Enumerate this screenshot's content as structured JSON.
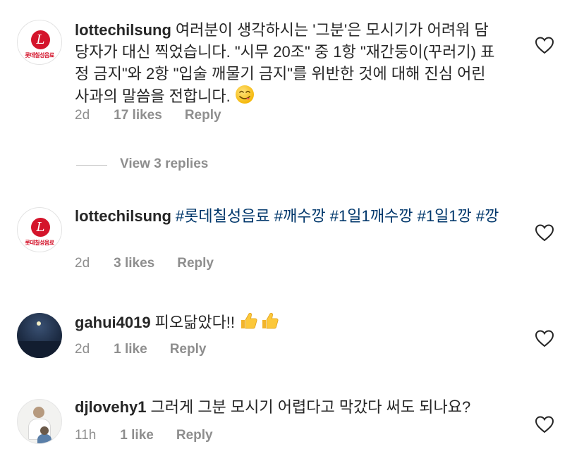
{
  "icons": {
    "like": "heart-outline-icon",
    "emoji_yum": "face-savoring-food-emoji",
    "emoji_thumbs": "thumbs-up-emoji"
  },
  "colors": {
    "username": "#262626",
    "hashtag": "#00376b",
    "meta": "#8e8e8e",
    "brand_red": "#d4142b"
  },
  "comments": [
    {
      "username": "lottechilsung",
      "avatar_mark": "L",
      "avatar_brand": "롯데칠성음료",
      "text": "여러분이 생각하시는 '그분'은 모시기가 어려워 담당자가 대신 찍었습니다. \"시무 20조\" 중 1항 \"재간둥이(꾸러기) 표정 금지\"와 2항 \"입술 깨물기 금지\"를 위반한 것에 대해 진심 어린 사과의 말씀을 전합니다.",
      "time": "2d",
      "likes": "17 likes",
      "reply": "Reply"
    },
    {
      "username": "lottechilsung",
      "avatar_mark": "L",
      "avatar_brand": "롯데칠성음료",
      "hashtags": [
        "#롯데칠성음료",
        "#깨수깡",
        "#1일1깨수깡",
        "#1일1깡",
        "#깡"
      ],
      "time": "2d",
      "likes": "3 likes",
      "reply": "Reply"
    },
    {
      "username": "gahui4019",
      "text": "피오닮았다!!",
      "time": "2d",
      "likes": "1 like",
      "reply": "Reply"
    },
    {
      "username": "djlovehy1",
      "text": "그러게 그분 모시기 어렵다고 막갔다 써도 되나요?",
      "time": "11h",
      "likes": "1 like",
      "reply": "Reply"
    }
  ],
  "view_replies": "View 3 replies"
}
